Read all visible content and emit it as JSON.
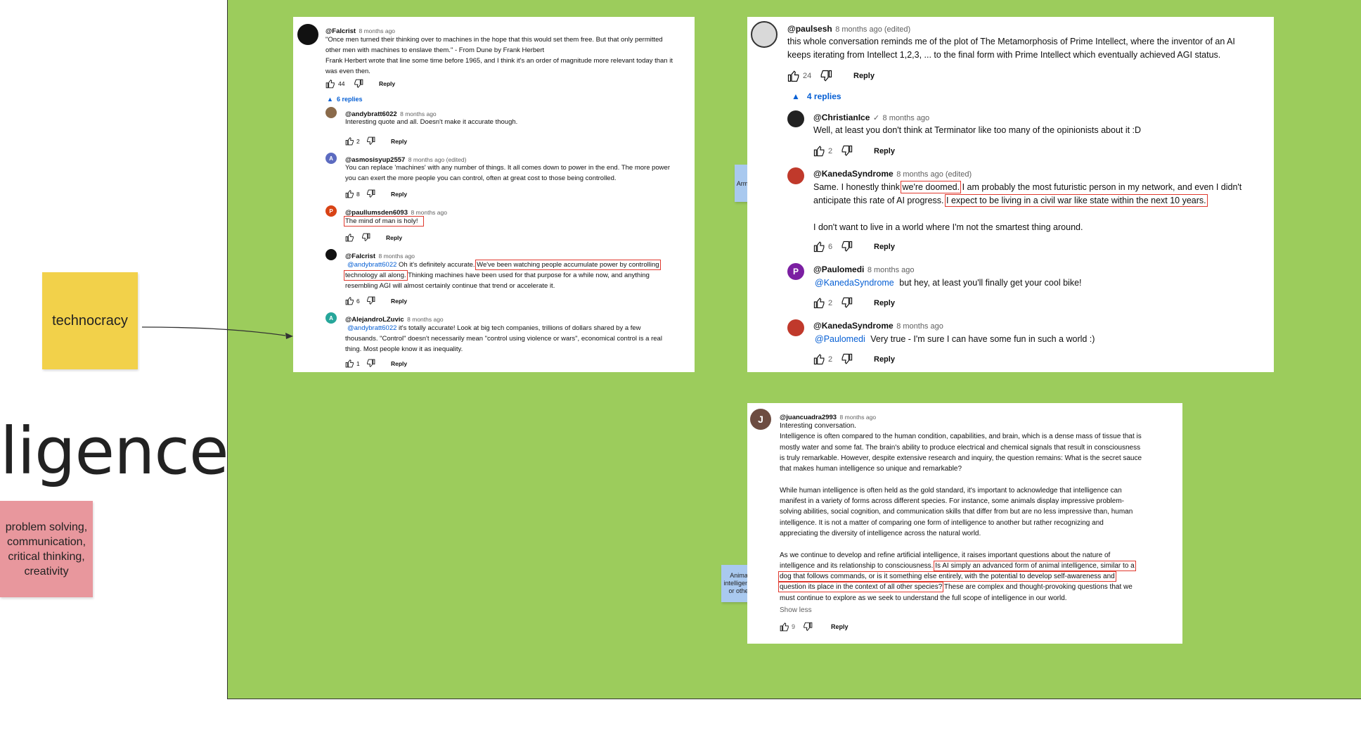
{
  "canvas": {
    "big_title": "ligence?",
    "sticky_technocracy": "technocracy",
    "sticky_skills_lines": [
      "problem solving,",
      "communication,",
      "critical thinking,",
      "creativity"
    ],
    "sticky_armagedon": "Armagedon",
    "sticky_animal_lines": [
      "Animal",
      "intelligence",
      "or other"
    ],
    "colors": {
      "frame_bg": "#9ccc5c",
      "yellow_sticky": "#f2d14a",
      "pink_sticky": "#e8979d",
      "blue_sticky": "#a9c9ef",
      "highlight": "#e03a2f",
      "link": "#065fd4"
    }
  },
  "card1": {
    "top": {
      "handle": "@Falcrist",
      "time": "8 months ago",
      "lines": [
        "\"Once men turned their thinking over to machines in the hope that this would set them free. But that only permitted",
        "other men with machines to enslave them.\" - From Dune by Frank Herbert",
        "Frank Herbert wrote that line some time before 1965, and I think it's an order of magnitude more relevant today than it",
        "was even then."
      ],
      "likes": "44",
      "reply": "Reply",
      "replies_toggle": "6 replies"
    },
    "replies": [
      {
        "handle": "@andybratt6022",
        "time": "8 months ago",
        "avatar_letter": "",
        "lines": [
          "Interesting quote and all. Doesn't make it accurate though."
        ],
        "likes": "2",
        "reply": "Reply"
      },
      {
        "handle": "@asmosisyup2557",
        "time": "8 months ago (edited)",
        "avatar_letter": "A",
        "lines": [
          "You can replace 'machines' with any number of things. It all comes down to power in the end. The more power",
          "you can exert the more people you can control, often at great cost to those being controlled."
        ],
        "likes": "8",
        "reply": "Reply"
      },
      {
        "handle": "@paullumsden6093",
        "time": "8 months ago",
        "avatar_letter": "P",
        "highlight": "The mind of man is holy!",
        "likes": "",
        "reply": "Reply"
      },
      {
        "handle": "@Falcrist",
        "time": "8 months ago",
        "avatar_letter": "",
        "mention": "@andybratt6022",
        "line1_pre": "Oh it's definitely accurate.",
        "line1_hl": "We've been watching people accumulate power by controlling",
        "line2_hl": "technology all along.",
        "line2_post": "Thinking machines have been used for that purpose for a while now, and anything",
        "line3": "resembling AGI will almost certainly continue that trend or accelerate it.",
        "likes": "6",
        "reply": "Reply"
      },
      {
        "handle": "@AlejandroLZuvic",
        "time": "8 months ago",
        "avatar_letter": "A",
        "mention": "@andybratt6022",
        "line1_post": "it's totally accurate! Look at big tech companies, trillions of dollars shared by a few",
        "line2": "thousands. \"Control\" doesn't necessarily mean \"control using violence or wars\", economical control is a real",
        "line3": "thing. Most people know it as inequality.",
        "likes": "1",
        "reply": "Reply"
      }
    ]
  },
  "card2": {
    "top": {
      "handle": "@paulsesh",
      "time": "8 months ago (edited)",
      "lines": [
        "this whole conversation reminds me of the plot of The Metamorphosis of Prime Intellect, where the inventor of an AI",
        "keeps iterating from Intellect 1,2,3, ... to the final form with Prime Intellect which eventually achieved AGI status."
      ],
      "likes": "24",
      "reply": "Reply",
      "replies_toggle": "4 replies"
    },
    "replies": [
      {
        "handle": "@ChristianIce",
        "verified": "✓",
        "time": "8 months ago",
        "line": "Well, at least you don't think at Terminator like too many of the opinionists about it :D",
        "likes": "2",
        "reply": "Reply"
      },
      {
        "handle": "@KanedaSyndrome",
        "time": "8 months ago (edited)",
        "l1_pre": "Same. I honestly think",
        "l1_hl": "we're doomed.",
        "l1_post": "I am probably the most futuristic person in my network, and even I didn't",
        "l2_pre": "anticipate this rate of AI progress.",
        "l2_hl": "I expect to be living in a civil war like state within the next 10 years.",
        "l3": "I don't want to live in a world where I'm not the smartest thing around.",
        "likes": "6",
        "reply": "Reply"
      },
      {
        "handle": "@Paulomedi",
        "time": "8 months ago",
        "avatar_letter": "P",
        "mention": "@KanedaSyndrome",
        "line": "but hey, at least you'll finally get your cool bike!",
        "likes": "2",
        "reply": "Reply"
      },
      {
        "handle": "@KanedaSyndrome",
        "time": "8 months ago",
        "mention": "@Paulomedi",
        "line": "Very true - I'm sure I can have some fun in such a world :)",
        "likes": "2",
        "reply": "Reply"
      }
    ]
  },
  "card3": {
    "handle": "@juancuadra2993",
    "time": "8 months ago",
    "avatar_letter": "J",
    "p1": [
      "Interesting conversation.",
      "Intelligence is often compared to the human condition, capabilities, and brain, which is a dense mass of tissue that is",
      "mostly water and some fat. The brain's ability to produce electrical and chemical signals that result in consciousness",
      "is truly remarkable. However, despite extensive research and inquiry, the question remains: What is the secret sauce",
      "that makes human intelligence so unique and remarkable?"
    ],
    "p2": [
      "While human intelligence is often held as the gold standard, it's important to acknowledge that intelligence can",
      "manifest in a variety of forms across different species. For instance, some animals display impressive problem-",
      "solving abilities, social cognition, and communication skills that differ from but are no less impressive than, human",
      "intelligence. It is not a matter of comparing one form of intelligence to another but rather recognizing and",
      "appreciating the diversity of intelligence across the natural world."
    ],
    "p3_l1": "As we continue to develop and refine artificial intelligence, it raises important questions about the nature of",
    "p3_l2_pre": "intelligence and its relationship to consciousness.",
    "p3_l2_hl": "Is AI simply an advanced form of animal intelligence, similar to a",
    "p3_l3_hl": "dog that follows commands, or is it something else entirely, with the potential to develop self-awareness and",
    "p3_l4_hl": "question its place in the context of all other species?",
    "p3_l4_post": "These are complex and thought-provoking questions that we",
    "p3_l5": "must continue to explore as we seek to understand the full scope of intelligence in our world.",
    "show_less": "Show less",
    "likes": "9",
    "reply": "Reply"
  }
}
